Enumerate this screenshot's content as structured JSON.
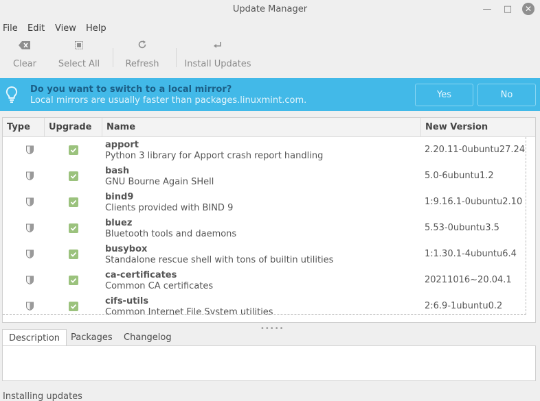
{
  "window": {
    "title": "Update Manager"
  },
  "menu": [
    "File",
    "Edit",
    "View",
    "Help"
  ],
  "toolbar": {
    "clear_label": "Clear",
    "select_all_label": "Select All",
    "refresh_label": "Refresh",
    "install_label": "Install Updates"
  },
  "infobar": {
    "question": "Do you want to switch to a local mirror?",
    "detail": "Local mirrors are usually faster than packages.linuxmint.com.",
    "yes_label": "Yes",
    "no_label": "No",
    "color": "#42b9e8"
  },
  "table": {
    "columns": [
      "Type",
      "Upgrade",
      "Name",
      "New Version"
    ],
    "rows": [
      {
        "name": "apport",
        "description": "Python 3 library for Apport crash report handling",
        "version": "2.20.11-0ubuntu27.24",
        "type_icon": "shield-icon",
        "upgrade": true
      },
      {
        "name": "bash",
        "description": "GNU Bourne Again SHell",
        "version": "5.0-6ubuntu1.2",
        "type_icon": "shield-icon",
        "upgrade": true
      },
      {
        "name": "bind9",
        "description": "Clients provided with BIND 9",
        "version": "1:9.16.1-0ubuntu2.10",
        "type_icon": "shield-icon",
        "upgrade": true
      },
      {
        "name": "bluez",
        "description": "Bluetooth tools and daemons",
        "version": "5.53-0ubuntu3.5",
        "type_icon": "shield-icon",
        "upgrade": true
      },
      {
        "name": "busybox",
        "description": "Standalone rescue shell with tons of builtin utilities",
        "version": "1:1.30.1-4ubuntu6.4",
        "type_icon": "shield-icon",
        "upgrade": true
      },
      {
        "name": "ca-certificates",
        "description": "Common CA certificates",
        "version": "20211016~20.04.1",
        "type_icon": "shield-icon",
        "upgrade": true
      },
      {
        "name": "cifs-utils",
        "description": "Common Internet File System utilities",
        "version": "2:6.9-1ubuntu0.2",
        "type_icon": "shield-icon",
        "upgrade": true
      }
    ]
  },
  "tabs": [
    "Description",
    "Packages",
    "Changelog"
  ],
  "status": "Installing updates"
}
